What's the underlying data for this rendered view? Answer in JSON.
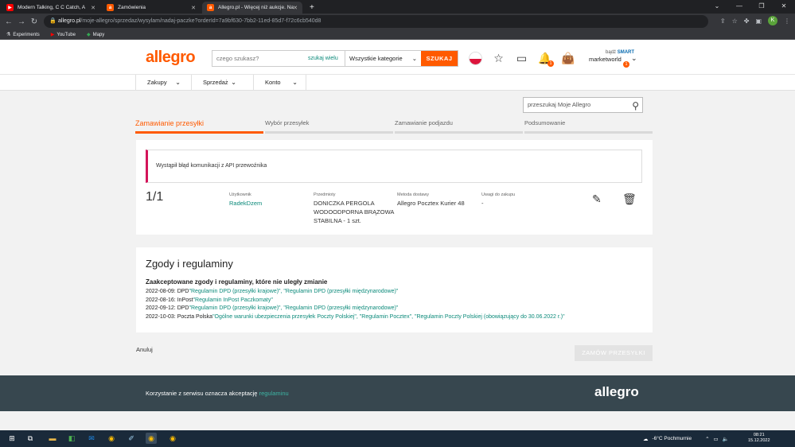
{
  "browser": {
    "tabs": [
      {
        "title": "Modern Talking, C C Catch, A",
        "favicon": "youtube-icon",
        "color": "#ff0000"
      },
      {
        "title": "Zamówienia",
        "favicon": "allegro-icon",
        "color": "#ff5a00"
      },
      {
        "title": "Allegro.pl - Więcej niż aukcje. Na",
        "favicon": "allegro-icon",
        "color": "#ff5a00"
      }
    ],
    "url_domain": "allegro.pl",
    "url_path": "/moje-allegro/sprzedaz/wysylam/nadaj-paczke?orderId=7a9bf630-7bb2-11ed-85d7-f72c6cb540d8",
    "avatar_letter": "K",
    "bookmarks": [
      "Experiments",
      "YouTube",
      "Mapy"
    ]
  },
  "header": {
    "logo": "allegro",
    "search_placeholder": "czego szukasz?",
    "search_wide": "szukaj wielu",
    "category": "Wszystkie kategorie",
    "search_button": "SZUKAJ",
    "notif_badge": "1",
    "smart_prefix": "bądź",
    "smart_label": "SMART",
    "username": "marketworld",
    "user_badge": "1"
  },
  "subnav": [
    "Zakupy",
    "Sprzedaż",
    "Konto"
  ],
  "ma_search_placeholder": "przeszukaj Moje Allegro",
  "steps": [
    "Zamawianie przesyłki",
    "Wybór przesyłek",
    "Zamawianie podjazdu",
    "Podsumowanie"
  ],
  "error_message": "Wystąpił błąd komunikacji z API przewoźnika",
  "order": {
    "count": "1/1",
    "user_label": "Użytkownik",
    "user_value": "RadekDzem",
    "items_label": "Przedmioty",
    "items_value": [
      "DONICZKA PERGOLA",
      "WODOODPORNA BRĄZOWA",
      "STABILNA - 1 szt."
    ],
    "delivery_label": "Metoda dostawy",
    "delivery_value": "Allegro Pocztex Kurier 48",
    "notes_label": "Uwagi do zakupu",
    "notes_value": "-"
  },
  "consents": {
    "title": "Zgody i regulaminy",
    "subtitle": "Zaakceptowane zgody i regulaminy, które nie uległy zmianie",
    "lines": [
      {
        "prefix": "2022-08-09: DPD",
        "links": "\"Regulamin DPD (przesyłki krajowe)\", \"Regulamin DPD (przesyłki międzynarodowe)\""
      },
      {
        "prefix": "2022-08-16: InPost",
        "links": "\"Regulamin InPost Paczkomaty\""
      },
      {
        "prefix": "2022-09-12: DPD",
        "links": "\"Regulamin DPD (przesyłki krajowe)\", \"Regulamin DPD (przesyłki międzynarodowe)\""
      },
      {
        "prefix": "2022-10-03: Poczta Polska",
        "links": "\"Ogólne warunki ubezpieczenia przesyłek Poczty Polskiej\", \"Regulamin Pocztex\", \"Regulamin Poczty Polskiej (obowiązujący do 30.06.2022 r.)\""
      }
    ]
  },
  "cancel_label": "Anuluj",
  "order_button": "ZAMÓW PRZESYŁKI",
  "footer": {
    "text": "Korzystanie z serwisu oznacza akceptację",
    "link": "regulaminu",
    "logo": "allegro"
  },
  "taskbar": {
    "weather": "-6°C  Pochmurnie",
    "time": "08:21",
    "date": "15.12.2022"
  },
  "colors": {
    "accent": "#ff5a00",
    "link": "#0b8a7a",
    "error": "#d4145a",
    "footer": "#37474f"
  }
}
